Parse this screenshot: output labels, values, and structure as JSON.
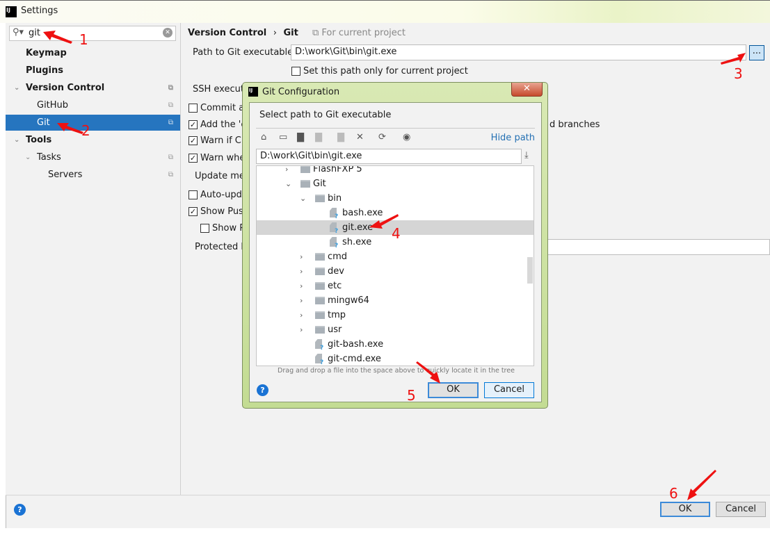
{
  "window": {
    "title": "Settings",
    "app_icon": "IJ"
  },
  "sidebar": {
    "search_value": "git",
    "items": [
      {
        "label": "Keymap"
      },
      {
        "label": "Plugins"
      },
      {
        "label": "Version Control"
      },
      {
        "label": "GitHub"
      },
      {
        "label": "Git"
      },
      {
        "label": "Tools"
      },
      {
        "label": "Tasks"
      },
      {
        "label": "Servers"
      }
    ]
  },
  "main": {
    "breadcrumb": [
      "Version Control",
      "Git"
    ],
    "breadcrumb_sep": "›",
    "scope": "For current project",
    "path_label": "Path to Git executable:",
    "path_value": "D:\\work\\Git\\bin\\git.exe",
    "browse_label": "...",
    "current_project_only": "Set this path only for current project",
    "ssh_label": "SSH executa",
    "options": [
      {
        "label": "Commit au",
        "checked": false
      },
      {
        "label": "Add the 'c",
        "suffix": "d branches",
        "checked": true
      },
      {
        "label": "Warn if CR",
        "checked": true
      },
      {
        "label": "Warn wher",
        "checked": true
      }
    ],
    "update_label": "Update met",
    "auto_update": {
      "label": "Auto-upda",
      "checked": false
    },
    "show_push": {
      "label": "Show Push",
      "checked": true
    },
    "show_p": {
      "label": "Show P",
      "checked": false
    },
    "protected_label": "Protected b"
  },
  "footer": {
    "ok": "OK",
    "cancel": "Cancel",
    "help": "?"
  },
  "dialog": {
    "title": "Git Configuration",
    "app_icon": "IJ",
    "close": "✕",
    "heading": "Select path to Git executable",
    "hide_path": "Hide path",
    "path_value": "D:\\work\\Git\\bin\\git.exe",
    "tree": [
      {
        "label": "FlashFXP 5",
        "type": "folder",
        "level": 1,
        "expanded": false
      },
      {
        "label": "Git",
        "type": "folder",
        "level": 1,
        "expanded": true
      },
      {
        "label": "bin",
        "type": "folder",
        "level": 2,
        "expanded": true
      },
      {
        "label": "bash.exe",
        "type": "file",
        "level": 3
      },
      {
        "label": "git.exe",
        "type": "file",
        "level": 3,
        "selected": true
      },
      {
        "label": "sh.exe",
        "type": "file",
        "level": 3
      },
      {
        "label": "cmd",
        "type": "folder",
        "level": 2,
        "expanded": false
      },
      {
        "label": "dev",
        "type": "folder",
        "level": 2,
        "expanded": false
      },
      {
        "label": "etc",
        "type": "folder",
        "level": 2,
        "expanded": false
      },
      {
        "label": "mingw64",
        "type": "folder",
        "level": 2,
        "expanded": false
      },
      {
        "label": "tmp",
        "type": "folder",
        "level": 2,
        "expanded": false
      },
      {
        "label": "usr",
        "type": "folder",
        "level": 2,
        "expanded": false
      },
      {
        "label": "git-bash.exe",
        "type": "file",
        "level": 2
      },
      {
        "label": "git-cmd.exe",
        "type": "file",
        "level": 2
      }
    ],
    "hint": "Drag and drop a file into the space above to quickly locate it in the tree",
    "ok": "OK",
    "cancel": "Cancel",
    "help": "?"
  },
  "annotations": [
    "1",
    "2",
    "3",
    "4",
    "5",
    "6"
  ],
  "colors": {
    "selection": "#2675bf",
    "annotation": "#ee1111",
    "link": "#2470b3"
  }
}
